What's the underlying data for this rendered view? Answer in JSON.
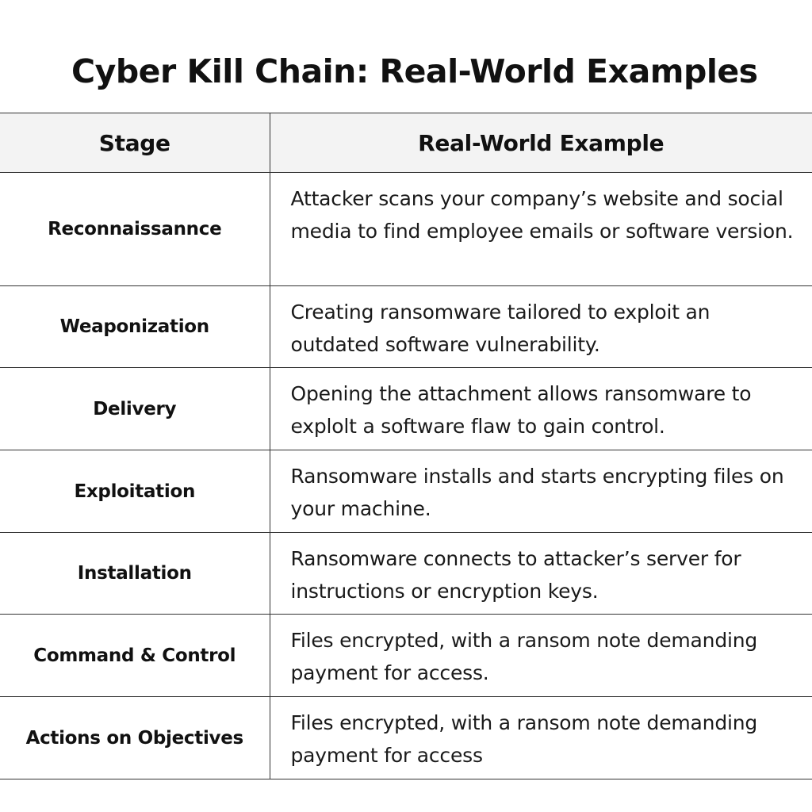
{
  "title": "Cyber Kill Chain: Real-World Examples",
  "table": {
    "headers": [
      "Stage",
      "Real-World Example"
    ],
    "rows": [
      {
        "stage": "Reconnaissannce",
        "example": "Attacker scans your company’s website and social media to find employee emails or software version."
      },
      {
        "stage": "Weaponization",
        "example": "Creating ransomware tailored to exploit an outdated software vulnerability."
      },
      {
        "stage": "Delivery",
        "example": "Opening the attachment allows ransomware to explolt a software flaw to gain control."
      },
      {
        "stage": "Exploitation",
        "example": "Ransomware installs and starts encrypting files on your machine."
      },
      {
        "stage": "Installation",
        "example": "Ransomware connects to attacker’s server for instructions or encryption keys."
      },
      {
        "stage": "Command & Control",
        "example": "Files encrypted, with a ransom note demanding payment for access."
      },
      {
        "stage": "Actions on Objectives",
        "example": "Files encrypted, with a ransom note demanding payment for access"
      }
    ]
  }
}
